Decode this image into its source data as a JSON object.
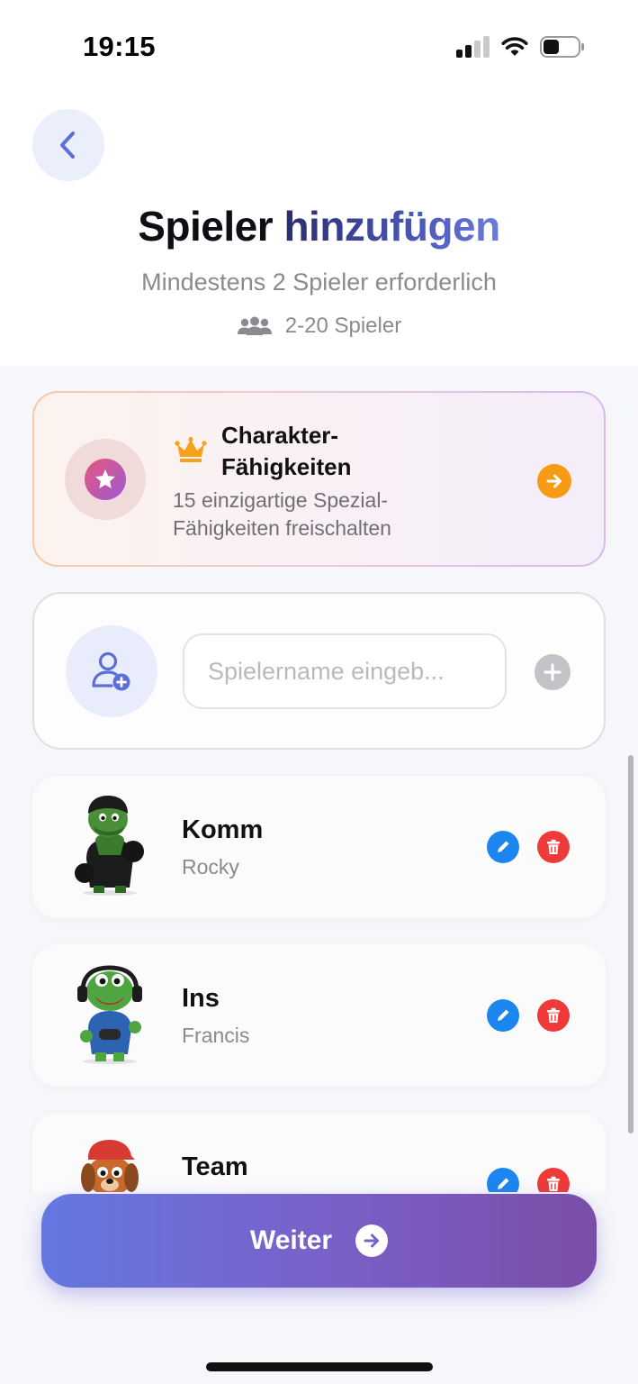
{
  "status_bar": {
    "time": "19:15"
  },
  "header": {
    "title_part1": "Spieler",
    "title_part2": "hinzufügen",
    "subtitle": "Mindestens 2 Spieler erforderlich",
    "player_range": "2-20 Spieler"
  },
  "promo": {
    "title": "Charakter-Fähigkeiten",
    "description": "15 einzigartige Spezial-Fähigkeiten freischalten",
    "accent_color": "#f69b13"
  },
  "add_player": {
    "placeholder": "Spielername eingeb...",
    "value": ""
  },
  "players": [
    {
      "name": "Komm",
      "character": "Rocky"
    },
    {
      "name": "Ins",
      "character": "Francis"
    },
    {
      "name": "Team",
      "character": ""
    }
  ],
  "footer": {
    "continue_label": "Weiter"
  },
  "colors": {
    "edit": "#1b86f0",
    "delete": "#ef3a3a",
    "primary_gradient_start": "#6478e2",
    "primary_gradient_end": "#7a4ea8"
  }
}
